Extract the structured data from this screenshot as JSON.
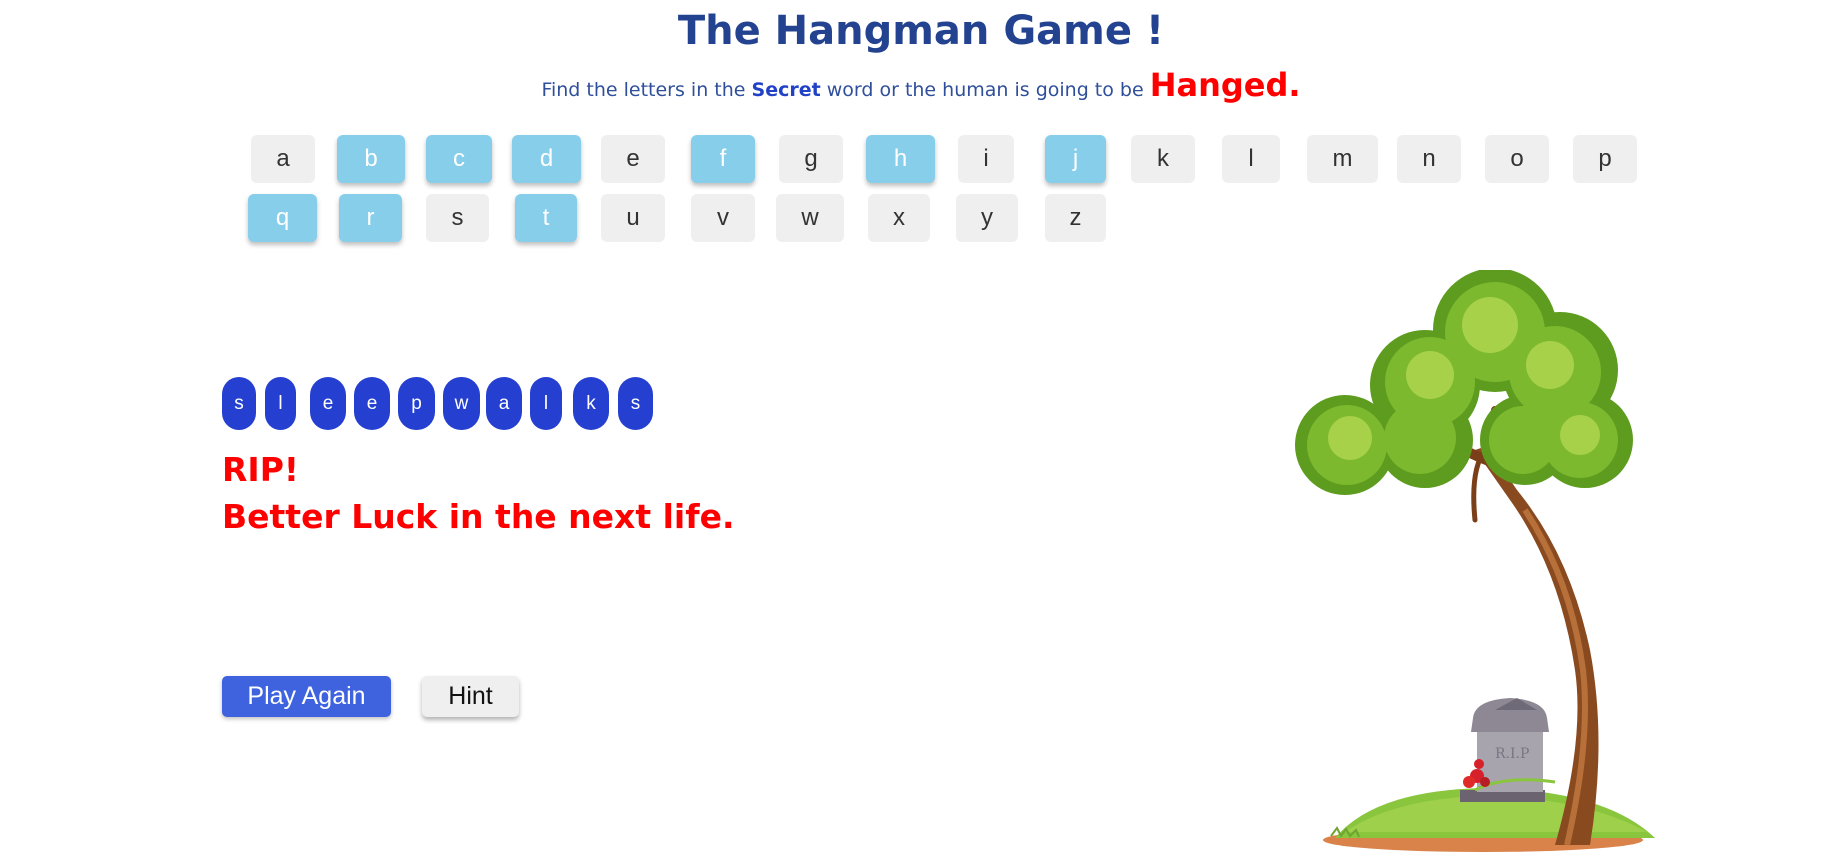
{
  "header": {
    "title": "The Hangman Game !",
    "subtitle_prefix": "Find the letters in the ",
    "subtitle_secret": "Secret",
    "subtitle_middle": " word or the human is going to be ",
    "subtitle_hanged": "Hanged."
  },
  "keyboard": {
    "row1": [
      {
        "letter": "a",
        "used": false
      },
      {
        "letter": "b",
        "used": true
      },
      {
        "letter": "c",
        "used": true
      },
      {
        "letter": "d",
        "used": true
      },
      {
        "letter": "e",
        "used": false
      },
      {
        "letter": "f",
        "used": true
      },
      {
        "letter": "g",
        "used": false
      },
      {
        "letter": "h",
        "used": true
      },
      {
        "letter": "i",
        "used": false
      },
      {
        "letter": "j",
        "used": true
      },
      {
        "letter": "k",
        "used": false
      },
      {
        "letter": "l",
        "used": false
      },
      {
        "letter": "m",
        "used": false
      },
      {
        "letter": "n",
        "used": false
      },
      {
        "letter": "o",
        "used": false
      },
      {
        "letter": "p",
        "used": false
      }
    ],
    "row2": [
      {
        "letter": "q",
        "used": true
      },
      {
        "letter": "r",
        "used": true
      },
      {
        "letter": "s",
        "used": false
      },
      {
        "letter": "t",
        "used": true
      },
      {
        "letter": "u",
        "used": false
      },
      {
        "letter": "v",
        "used": false
      },
      {
        "letter": "w",
        "used": false
      },
      {
        "letter": "x",
        "used": false
      },
      {
        "letter": "y",
        "used": false
      },
      {
        "letter": "z",
        "used": false
      }
    ]
  },
  "secret_word": [
    "s",
    "l",
    "e",
    "e",
    "p",
    "w",
    "a",
    "l",
    "k",
    "s"
  ],
  "result": {
    "line1": "RIP!",
    "line2": "Better Luck in the next life."
  },
  "buttons": {
    "play_again": "Play Again",
    "hint": "Hint"
  },
  "scene": {
    "tombstone_text": "R.I.P"
  },
  "colors": {
    "used_key": "#87ceeb",
    "unused_key": "#efefef",
    "word_pill": "#2540d0",
    "alert_red": "#ff0000",
    "title_blue": "#234390"
  }
}
